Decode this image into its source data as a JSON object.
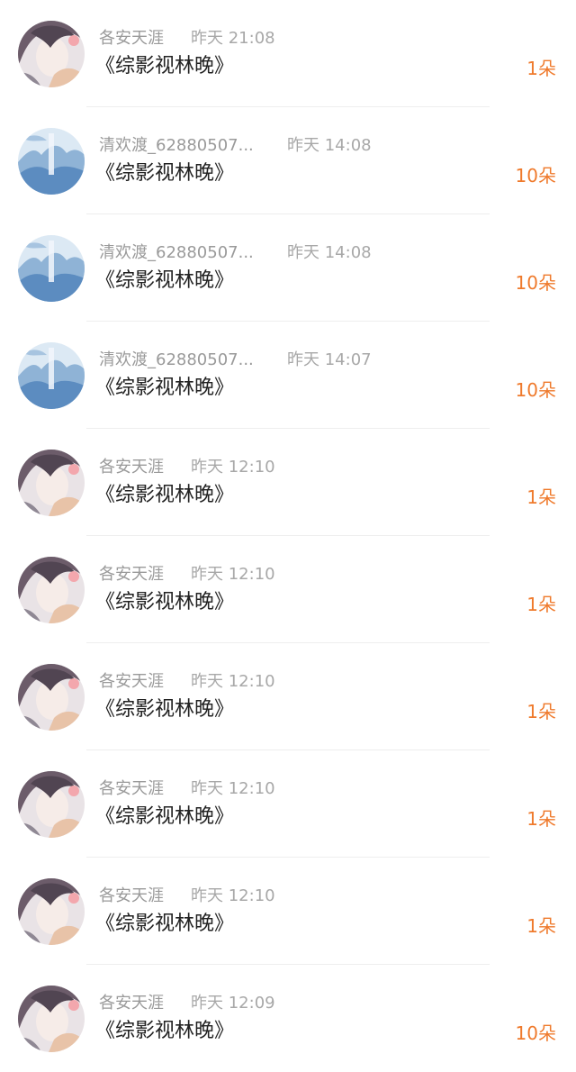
{
  "items": [
    {
      "avatar": "anime-girl-avatar",
      "name": "各安天涯",
      "time": "昨天 21:08",
      "title": "《综影视林晚》",
      "gift": "1朵"
    },
    {
      "avatar": "blue-landscape-avatar",
      "name": "清欢渡_62880507...",
      "time": "昨天 14:08",
      "title": "《综影视林晚》",
      "gift": "10朵"
    },
    {
      "avatar": "blue-landscape-avatar",
      "name": "清欢渡_62880507...",
      "time": "昨天 14:08",
      "title": "《综影视林晚》",
      "gift": "10朵"
    },
    {
      "avatar": "blue-landscape-avatar",
      "name": "清欢渡_62880507...",
      "time": "昨天 14:07",
      "title": "《综影视林晚》",
      "gift": "10朵"
    },
    {
      "avatar": "anime-girl-avatar",
      "name": "各安天涯",
      "time": "昨天 12:10",
      "title": "《综影视林晚》",
      "gift": "1朵"
    },
    {
      "avatar": "anime-girl-avatar",
      "name": "各安天涯",
      "time": "昨天 12:10",
      "title": "《综影视林晚》",
      "gift": "1朵"
    },
    {
      "avatar": "anime-girl-avatar",
      "name": "各安天涯",
      "time": "昨天 12:10",
      "title": "《综影视林晚》",
      "gift": "1朵"
    },
    {
      "avatar": "anime-girl-avatar",
      "name": "各安天涯",
      "time": "昨天 12:10",
      "title": "《综影视林晚》",
      "gift": "1朵"
    },
    {
      "avatar": "anime-girl-avatar",
      "name": "各安天涯",
      "time": "昨天 12:10",
      "title": "《综影视林晚》",
      "gift": "1朵"
    },
    {
      "avatar": "anime-girl-avatar",
      "name": "各安天涯",
      "time": "昨天 12:09",
      "title": "《综影视林晚》",
      "gift": "10朵"
    }
  ],
  "colors": {
    "name": "#9a9a9a",
    "time": "#a8a8a8",
    "title": "#222222",
    "gift": "#ef7a2c",
    "divider": "#eeeeee"
  }
}
